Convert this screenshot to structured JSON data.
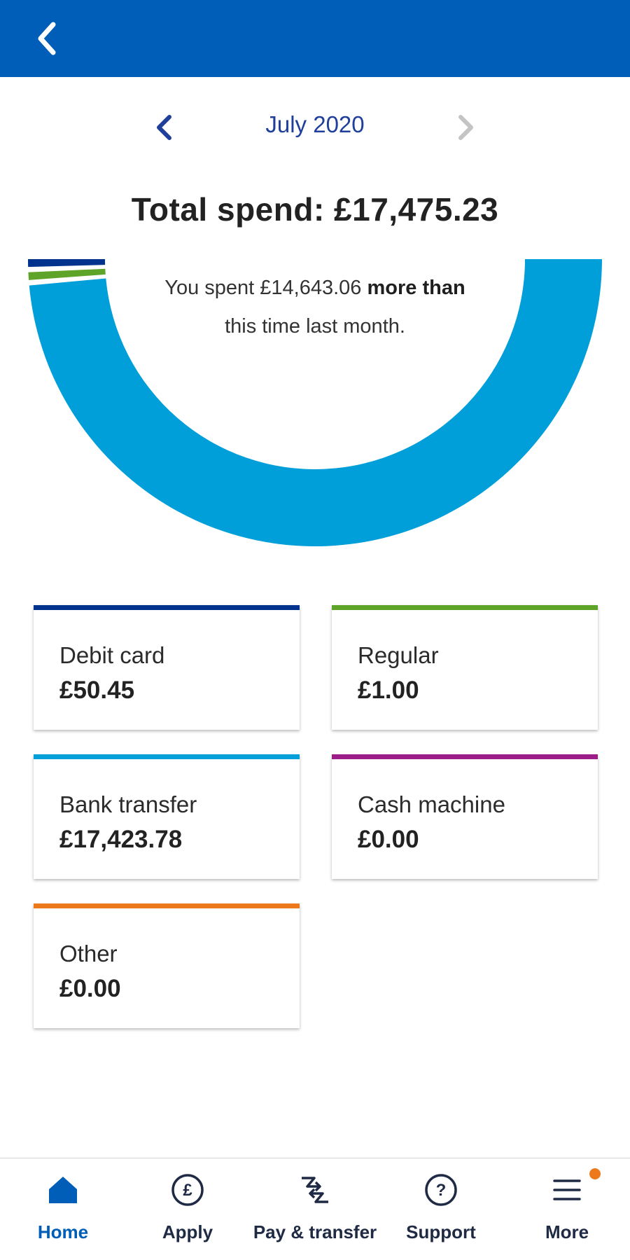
{
  "header": {
    "back_icon": "chevron-left-icon"
  },
  "month_nav": {
    "label": "July 2020",
    "prev_icon": "chevron-left-icon",
    "next_icon": "chevron-right-icon",
    "next_enabled": false
  },
  "summary": {
    "total_label": "Total spend: £17,475.23",
    "comparison_prefix": "You spent £14,643.06 ",
    "comparison_bold": "more than",
    "comparison_suffix": " this time last month."
  },
  "donut": {
    "segments": [
      {
        "name": "Debit card",
        "value": 50.45,
        "color": "#00338d"
      },
      {
        "name": "Regular",
        "value": 1.0,
        "color": "#5ea428"
      },
      {
        "name": "Bank transfer",
        "value": 17423.78,
        "color": "#009fda"
      }
    ]
  },
  "categories": [
    {
      "label": "Debit card",
      "value": "£50.45",
      "color": "#00338d"
    },
    {
      "label": "Regular",
      "value": "£1.00",
      "color": "#5ea428"
    },
    {
      "label": "Bank transfer",
      "value": "£17,423.78",
      "color": "#009fda"
    },
    {
      "label": "Cash machine",
      "value": "£0.00",
      "color": "#9c1c88"
    },
    {
      "label": "Other",
      "value": "£0.00",
      "color": "#ec7a1c"
    }
  ],
  "bottom_nav": {
    "items": [
      {
        "label": "Home",
        "icon": "home-icon",
        "active": true
      },
      {
        "label": "Apply",
        "icon": "pound-circle-icon",
        "active": false
      },
      {
        "label": "Pay & transfer",
        "icon": "transfer-arrows-icon",
        "active": false
      },
      {
        "label": "Support",
        "icon": "question-circle-icon",
        "active": false
      },
      {
        "label": "More",
        "icon": "menu-icon",
        "active": false,
        "has_badge": true
      }
    ]
  },
  "colors": {
    "brand_blue": "#005eb8",
    "month_text": "#1f3f9a",
    "badge_orange": "#ec7a1c"
  }
}
